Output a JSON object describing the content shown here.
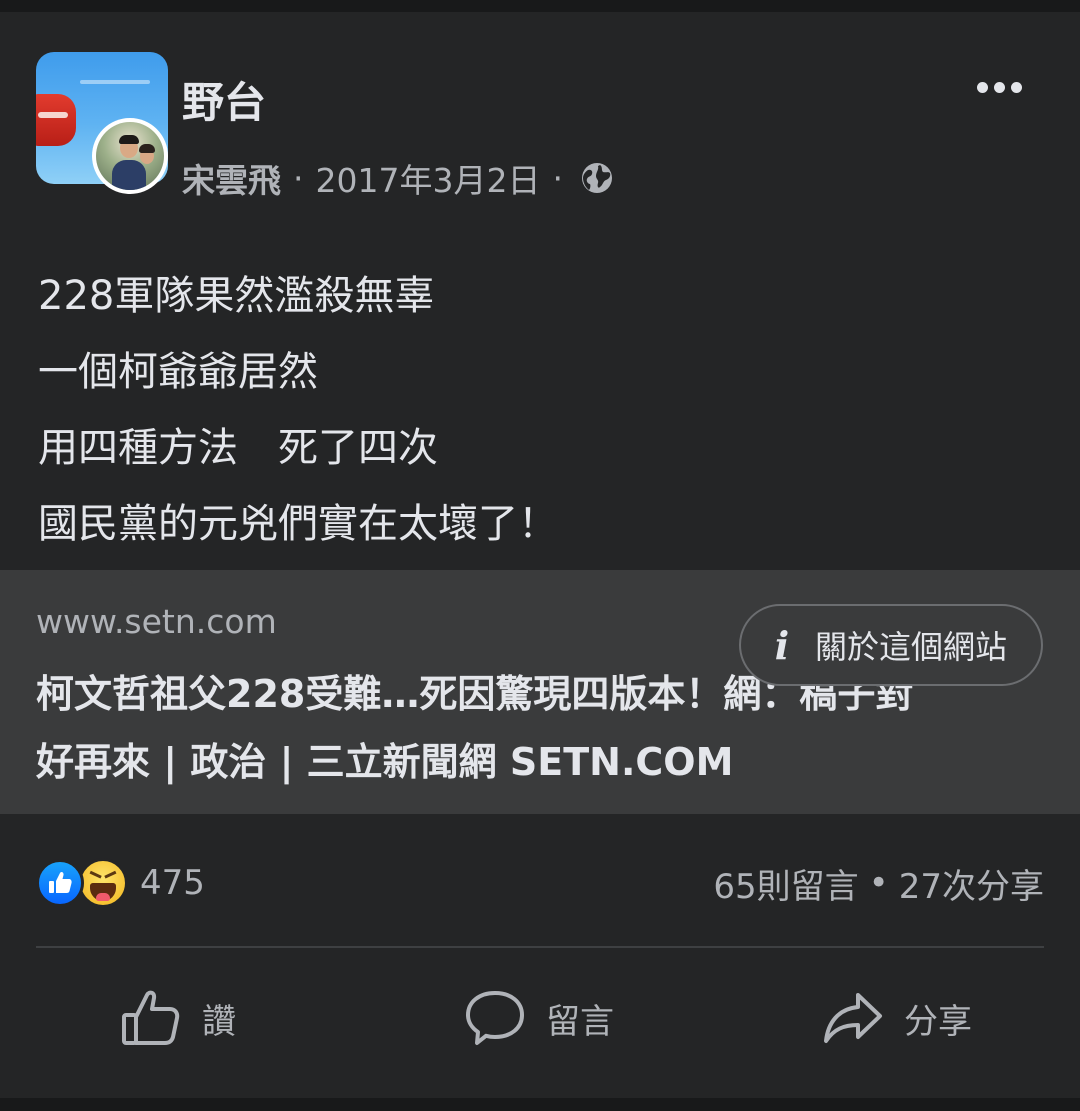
{
  "post": {
    "page_name": "野台",
    "author": "宋雲飛",
    "separator": "·",
    "date": "2017年3月2日",
    "visibility_icon": "globe-icon",
    "text": "228軍隊果然濫殺無辜\n一個柯爺爺居然\n用四種方法　死了四次\n國民黨的元兇們實在太壞了！"
  },
  "link_preview": {
    "domain": "www.setn.com",
    "title": "柯文哲祖父228受難…死因驚現四版本！網：稿子對\n好再來 | 政治 | 三立新聞網 SETN.COM",
    "about_label": "關於這個網站"
  },
  "engagement": {
    "reaction_icons": [
      "like-icon",
      "haha-icon"
    ],
    "reaction_count": "475",
    "comments": "65則留言",
    "dot": "•",
    "shares": "27次分享"
  },
  "actions": {
    "like_label": "讚",
    "comment_label": "留言",
    "share_label": "分享"
  },
  "colors": {
    "background": "#18191a",
    "card": "#242526",
    "link_card": "#3a3b3c",
    "primary_text": "#e4e6eb",
    "secondary_text": "#b0b3b8",
    "like_blue": "#0866ff"
  }
}
